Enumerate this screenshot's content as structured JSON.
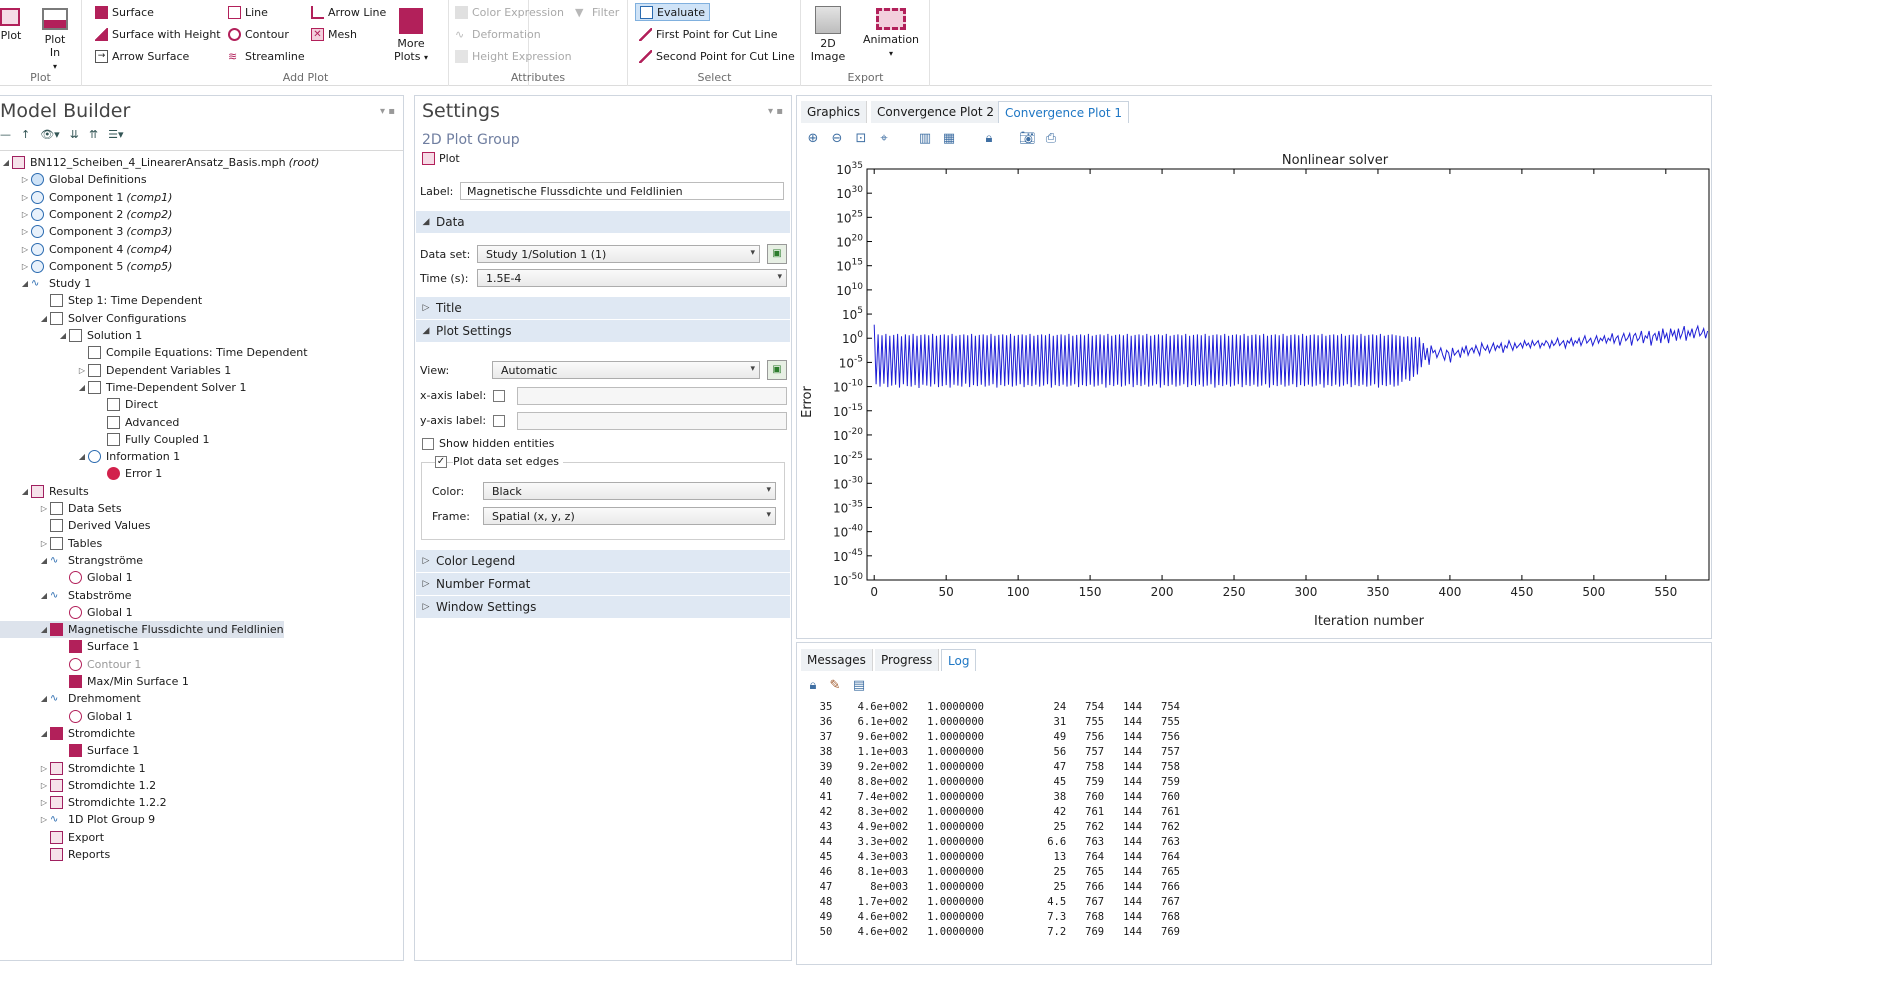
{
  "ribbon": {
    "plot_group": {
      "label": "Plot",
      "plot": "Plot",
      "plot_in": "Plot In"
    },
    "add_plot": {
      "label": "Add Plot",
      "surface": "Surface",
      "surface_height": "Surface with Height",
      "arrow_surface": "Arrow Surface",
      "line": "Line",
      "contour": "Contour",
      "streamline": "Streamline",
      "arrow_line": "Arrow Line",
      "mesh": "Mesh",
      "more_plots": "More Plots"
    },
    "attributes": {
      "label": "Attributes",
      "color_expression": "Color Expression",
      "filter": "Filter",
      "deformation": "Deformation",
      "height_expression": "Height Expression"
    },
    "select": {
      "label": "Select",
      "evaluate": "Evaluate",
      "first_point": "First Point for Cut Line",
      "second_point": "Second Point for Cut Line"
    },
    "export": {
      "label": "Export",
      "image_2d": "2D Image",
      "animation": "Animation"
    }
  },
  "model_builder": {
    "title": "Model Builder",
    "items": [
      {
        "label": "BN112_Scheiben_4_LinearerAnsatz_Basis.mph",
        "suffix": "(root)"
      },
      {
        "label": "Global Definitions",
        "suffix": ""
      },
      {
        "label": "Component 1",
        "suffix": "(comp1)"
      },
      {
        "label": "Component 2",
        "suffix": "(comp2)"
      },
      {
        "label": "Component 3",
        "suffix": "(comp3)"
      },
      {
        "label": "Component 4",
        "suffix": "(comp4)"
      },
      {
        "label": "Component 5",
        "suffix": "(comp5)"
      },
      {
        "label": "Study 1",
        "suffix": ""
      },
      {
        "label": "Step 1: Time Dependent",
        "suffix": ""
      },
      {
        "label": "Solver Configurations",
        "suffix": ""
      },
      {
        "label": "Solution 1",
        "suffix": ""
      },
      {
        "label": "Compile Equations: Time Dependent",
        "suffix": ""
      },
      {
        "label": "Dependent Variables 1",
        "suffix": ""
      },
      {
        "label": "Time-Dependent Solver 1",
        "suffix": ""
      },
      {
        "label": "Direct",
        "suffix": ""
      },
      {
        "label": "Advanced",
        "suffix": ""
      },
      {
        "label": "Fully Coupled 1",
        "suffix": ""
      },
      {
        "label": "Information 1",
        "suffix": ""
      },
      {
        "label": "Error 1",
        "suffix": ""
      },
      {
        "label": "Results",
        "suffix": ""
      },
      {
        "label": "Data Sets",
        "suffix": ""
      },
      {
        "label": "Derived Values",
        "suffix": ""
      },
      {
        "label": "Tables",
        "suffix": ""
      },
      {
        "label": "Strangströme",
        "suffix": ""
      },
      {
        "label": "Global 1",
        "suffix": ""
      },
      {
        "label": "Stabströme",
        "suffix": ""
      },
      {
        "label": "Global 1",
        "suffix": ""
      },
      {
        "label": "Magnetische Flussdichte und Feldlinien",
        "suffix": ""
      },
      {
        "label": "Surface 1",
        "suffix": ""
      },
      {
        "label": "Contour 1",
        "suffix": ""
      },
      {
        "label": "Max/Min Surface 1",
        "suffix": ""
      },
      {
        "label": "Drehmoment",
        "suffix": ""
      },
      {
        "label": "Global 1",
        "suffix": ""
      },
      {
        "label": "Stromdichte",
        "suffix": ""
      },
      {
        "label": "Surface 1",
        "suffix": ""
      },
      {
        "label": "Stromdichte 1",
        "suffix": ""
      },
      {
        "label": "Stromdichte 1.2",
        "suffix": ""
      },
      {
        "label": "Stromdichte 1.2.2",
        "suffix": ""
      },
      {
        "label": "1D Plot Group 9",
        "suffix": ""
      },
      {
        "label": "Export",
        "suffix": ""
      },
      {
        "label": "Reports",
        "suffix": ""
      }
    ]
  },
  "settings": {
    "title": "Settings",
    "subtitle": "2D Plot Group",
    "plot_btn": "Plot",
    "label_caption": "Label:",
    "label_value": "Magnetische Flussdichte und Feldlinien",
    "sec_data": "Data",
    "dataset_caption": "Data set:",
    "dataset_value": "Study 1/Solution 1 (1)",
    "time_caption": "Time (s):",
    "time_value": "1.5E-4",
    "sec_title": "Title",
    "sec_plot_settings": "Plot Settings",
    "view_caption": "View:",
    "view_value": "Automatic",
    "xaxis_caption": "x-axis label:",
    "yaxis_caption": "y-axis label:",
    "show_hidden": "Show hidden entities",
    "plot_edges": "Plot data set edges",
    "color_caption": "Color:",
    "color_value": "Black",
    "frame_caption": "Frame:",
    "frame_value": "Spatial  (x, y, z)",
    "sec_color_legend": "Color Legend",
    "sec_number_format": "Number Format",
    "sec_window": "Window Settings"
  },
  "graphics": {
    "tabs": [
      "Graphics",
      "Convergence Plot 2",
      "Convergence Plot 1"
    ]
  },
  "chart_data": {
    "type": "line",
    "title": "Nonlinear solver",
    "xlabel": "Iteration number",
    "ylabel": "Error",
    "xlim": [
      -5,
      580
    ],
    "ylim_exp": [
      -50,
      35
    ],
    "xticks": [
      0,
      50,
      100,
      150,
      200,
      250,
      300,
      350,
      400,
      450,
      500,
      550
    ],
    "yticks_exp": [
      35,
      30,
      25,
      20,
      15,
      10,
      5,
      0,
      -5,
      -10,
      -15,
      -20,
      -25,
      -30,
      -35,
      -40,
      -45,
      -50
    ],
    "grid": false,
    "log_y": true,
    "line_color": "#1f1fd6",
    "series": [
      {
        "values_log10": [
          2.8,
          -9.5,
          0.8,
          -10.0,
          0.6,
          -9.4,
          0.9,
          -10.1,
          0.5,
          -9.8,
          0.7,
          -9.6,
          0.9,
          -10.2,
          0.4,
          -9.5,
          0.8,
          -9.9,
          0.6,
          -10.0,
          0.9,
          -9.7,
          0.5,
          -10.3,
          0.7,
          -9.6,
          0.8,
          -9.8,
          0.6,
          -10.0,
          0.9,
          -9.5,
          0.5,
          -10.1,
          0.7,
          -9.9,
          0.8,
          -9.7,
          0.6,
          -10.2,
          0.9,
          -9.6,
          0.5,
          -9.8,
          0.7,
          -10.0,
          0.8,
          -9.4,
          0.6,
          -10.1,
          0.9,
          -9.7,
          0.5,
          -9.9,
          0.7,
          -9.6,
          0.8,
          -10.0,
          0.6,
          -9.8,
          0.9,
          -9.5,
          0.5,
          -10.2,
          0.7,
          -9.7,
          0.8,
          -9.9,
          0.6,
          -9.6,
          0.9,
          -10.0,
          0.5,
          -9.8,
          0.7,
          -9.5,
          0.8,
          -10.1,
          0.6,
          -9.7,
          0.9,
          -9.9,
          0.5,
          -9.6,
          0.7,
          -10.0,
          0.8,
          -9.8,
          0.6,
          -9.5,
          0.9,
          -10.2,
          0.5,
          -9.7,
          0.7,
          -9.9,
          0.8,
          -9.6,
          0.6,
          -10.0,
          0.9,
          -9.8,
          0.5,
          -9.5,
          0.7,
          -10.1,
          0.8,
          -9.7,
          0.6,
          -9.9,
          0.9,
          -9.6,
          0.5,
          -10.0,
          0.7,
          -9.8,
          0.8,
          -9.5,
          0.6,
          -10.2,
          0.9,
          -9.7,
          0.5,
          -9.9,
          0.7,
          -9.6,
          0.8,
          -10.0,
          0.6,
          -9.8,
          0.9,
          -9.5,
          0.5,
          -10.1,
          0.7,
          -9.7,
          0.8,
          -9.9,
          0.6,
          -9.6,
          0.9,
          -10.0,
          0.5,
          -9.8,
          0.7,
          -9.5,
          0.8,
          -10.2,
          0.6,
          -9.7,
          0.9,
          -9.9,
          0.5,
          -9.6,
          0.7,
          -10.0,
          0.8,
          -9.8,
          0.6,
          -9.5,
          0.9,
          -10.1,
          0.5,
          -9.7,
          0.7,
          -9.9,
          0.8,
          -9.6,
          0.6,
          -10.0,
          0.9,
          -9.8,
          0.5,
          -9.5,
          0.7,
          -10.2,
          0.8,
          -9.7,
          0.6,
          -9.9,
          0.9,
          -9.6,
          0.5,
          -10.0,
          0.7,
          -9.8,
          0.8,
          -9.5,
          0.6,
          -10.1,
          0.9,
          -9.7,
          0.5,
          -9.9,
          0.7,
          -9.6,
          0.8,
          -10.0,
          0.6,
          -9.8,
          0.9,
          -9.5,
          0.5,
          -10.2,
          0.7,
          -9.7,
          0.8,
          -9.9,
          0.6,
          -9.6,
          0.9,
          -10.0,
          0.5,
          -9.8,
          0.7,
          -9.5,
          0.8,
          -10.1,
          0.6,
          -9.7,
          0.9,
          -9.9,
          0.5,
          -9.6,
          0.7,
          -10.0,
          0.8,
          -9.8,
          0.6,
          -9.5,
          0.9,
          -10.2,
          0.5,
          -9.7,
          0.7,
          -9.9,
          0.8,
          -9.6,
          0.6,
          -10.0,
          0.9,
          -9.8,
          0.5,
          -9.5,
          0.7,
          -10.1,
          0.8,
          -9.7,
          0.6,
          -9.9,
          0.9,
          -9.6,
          0.5,
          -10.0,
          0.7,
          -9.8,
          0.8,
          -9.5,
          0.6,
          -10.2,
          0.9,
          -9.7,
          0.5,
          -9.9,
          0.7,
          -9.6,
          0.8,
          -10.0,
          0.6,
          -9.8,
          0.5,
          -9.0,
          0.3,
          -8.5,
          0.4,
          -8.8,
          0.2,
          -8.0,
          0.3,
          -7.5,
          0.2,
          -6.0,
          -1.0,
          -4.5,
          -2.0,
          -5.5,
          -1.5,
          -3.0,
          -2.5,
          -4.0,
          -3.0,
          -2.0,
          -3.5,
          -4.5,
          -2.5,
          -3.0,
          -5.0,
          -2.0,
          -3.5,
          -3.0,
          -2.5,
          -4.0,
          -2.0,
          -3.0,
          -1.5,
          -3.5,
          -2.5,
          -2.0,
          -3.0,
          -1.5,
          -2.5,
          -3.5,
          -1.0,
          -2.0,
          -2.5,
          -1.5,
          -3.0,
          -2.0,
          -1.0,
          -2.5,
          -1.5,
          -2.0,
          -1.0,
          -3.0,
          -1.5,
          -2.0,
          -0.5,
          -1.5,
          -2.5,
          -1.0,
          -2.0,
          -1.5,
          -1.0,
          -2.0,
          -0.5,
          -1.5,
          -1.0,
          -2.0,
          -0.5,
          -1.5,
          -1.0,
          -0.5,
          -2.0,
          -1.0,
          -1.5,
          -0.5,
          -1.0,
          -2.0,
          -0.5,
          -1.5,
          -1.0,
          0.0,
          -1.5,
          -1.0,
          -0.5,
          -2.0,
          -0.5,
          -1.0,
          0.0,
          -1.5,
          -0.5,
          -1.0,
          0.0,
          -1.5,
          -0.5,
          0.5,
          -1.0,
          -0.5,
          0.0,
          -1.5,
          -0.5,
          0.5,
          -1.0,
          0.0,
          -0.5,
          0.5,
          -1.0,
          0.0,
          -0.5,
          1.0,
          -1.0,
          0.0,
          0.5,
          -1.5,
          0.0,
          1.0,
          -0.5,
          0.0,
          1.0,
          -1.5,
          0.5,
          1.0,
          -0.5,
          0.0,
          1.5,
          -1.0,
          0.5,
          0.0,
          1.5,
          -1.5,
          0.5,
          1.0,
          -0.5,
          1.5,
          -1.0,
          2.0,
          0.0,
          1.0,
          -1.0,
          2.0,
          0.5,
          1.5,
          -0.5,
          2.0,
          0.0,
          1.0,
          2.5,
          -0.5,
          1.5,
          0.5,
          2.0,
          0.0,
          1.5,
          2.5,
          0.5,
          1.0,
          2.0,
          0.0,
          1.5
        ]
      }
    ]
  },
  "messages": {
    "tabs": [
      "Messages",
      "Progress",
      "Log"
    ],
    "log": [
      [
        "35",
        "4.6e+002",
        "1.0000000",
        "24",
        "754",
        "144",
        "754"
      ],
      [
        "36",
        "6.1e+002",
        "1.0000000",
        "31",
        "755",
        "144",
        "755"
      ],
      [
        "37",
        "9.6e+002",
        "1.0000000",
        "49",
        "756",
        "144",
        "756"
      ],
      [
        "38",
        "1.1e+003",
        "1.0000000",
        "56",
        "757",
        "144",
        "757"
      ],
      [
        "39",
        "9.2e+002",
        "1.0000000",
        "47",
        "758",
        "144",
        "758"
      ],
      [
        "40",
        "8.8e+002",
        "1.0000000",
        "45",
        "759",
        "144",
        "759"
      ],
      [
        "41",
        "7.4e+002",
        "1.0000000",
        "38",
        "760",
        "144",
        "760"
      ],
      [
        "42",
        "8.3e+002",
        "1.0000000",
        "42",
        "761",
        "144",
        "761"
      ],
      [
        "43",
        "4.9e+002",
        "1.0000000",
        "25",
        "762",
        "144",
        "762"
      ],
      [
        "44",
        "3.3e+002",
        "1.0000000",
        "6.6",
        "763",
        "144",
        "763"
      ],
      [
        "45",
        "4.3e+003",
        "1.0000000",
        "13",
        "764",
        "144",
        "764"
      ],
      [
        "46",
        "8.1e+003",
        "1.0000000",
        "25",
        "765",
        "144",
        "765"
      ],
      [
        "47",
        "8e+003",
        "1.0000000",
        "25",
        "766",
        "144",
        "766"
      ],
      [
        "48",
        "1.7e+002",
        "1.0000000",
        "4.5",
        "767",
        "144",
        "767"
      ],
      [
        "49",
        "4.6e+002",
        "1.0000000",
        "7.3",
        "768",
        "144",
        "768"
      ],
      [
        "50",
        "4.6e+002",
        "1.0000000",
        "7.2",
        "769",
        "144",
        "769"
      ]
    ]
  }
}
